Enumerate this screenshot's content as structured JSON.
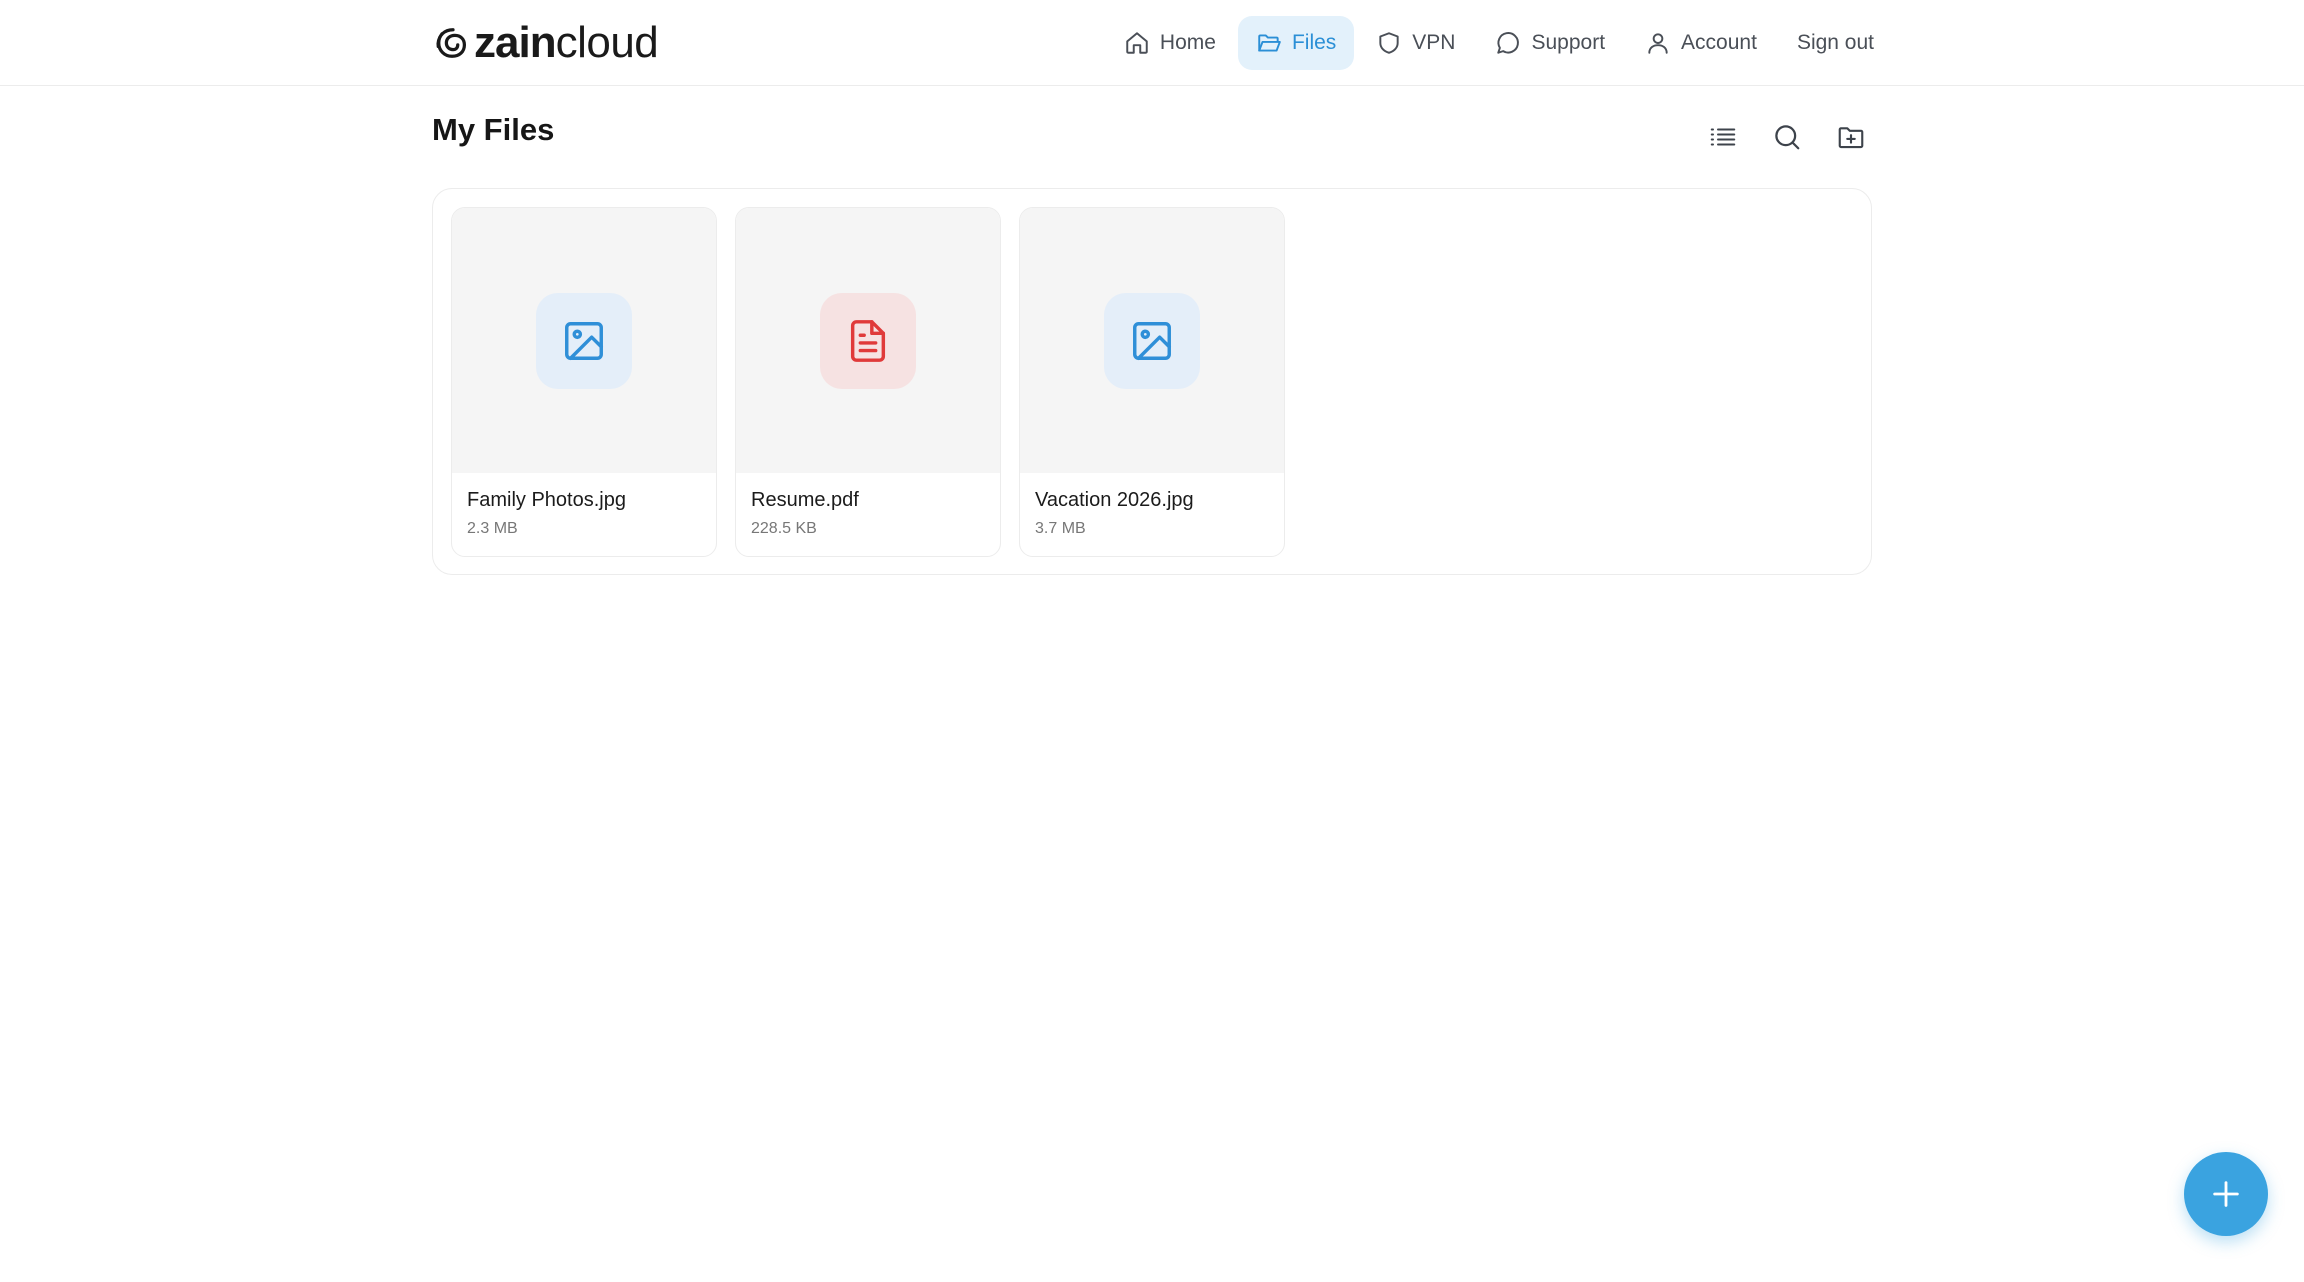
{
  "brand": {
    "name_bold": "zain",
    "name_light": "cloud",
    "logo_icon": "swirl-logo-icon"
  },
  "nav": {
    "items": [
      {
        "label": "Home",
        "icon": "home-icon",
        "active": false
      },
      {
        "label": "Files",
        "icon": "folder-open-icon",
        "active": true
      },
      {
        "label": "VPN",
        "icon": "shield-icon",
        "active": false
      },
      {
        "label": "Support",
        "icon": "chat-bubble-icon",
        "active": false
      },
      {
        "label": "Account",
        "icon": "user-icon",
        "active": false
      },
      {
        "label": "Sign out",
        "icon": "",
        "active": false
      }
    ]
  },
  "page": {
    "title": "My Files"
  },
  "toolbar": {
    "icons": [
      "list-view-icon",
      "search-icon",
      "new-folder-icon"
    ]
  },
  "files": [
    {
      "name": "Family Photos.jpg",
      "size": "2.3 MB",
      "type": "image"
    },
    {
      "name": "Resume.pdf",
      "size": "228.5 KB",
      "type": "pdf"
    },
    {
      "name": "Vacation 2026.jpg",
      "size": "3.7 MB",
      "type": "image"
    }
  ],
  "fab": {
    "icon": "plus-icon"
  },
  "colors": {
    "accent": "#3aa3e0",
    "nav_active_bg": "#e3f1fb",
    "nav_active_text": "#2b8fd6",
    "image_icon": "#2f8fd8",
    "pdf_icon": "#e03a3a"
  }
}
